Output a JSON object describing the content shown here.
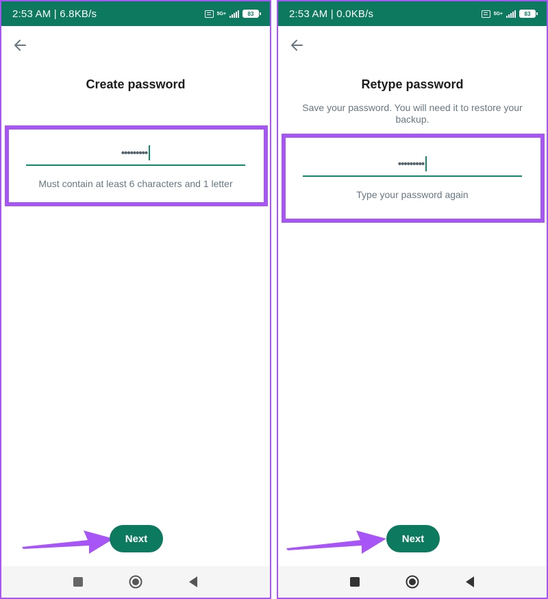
{
  "colors": {
    "accent": "#0d7a5f",
    "highlight": "#a855f7",
    "field_underline": "#0d8a6a"
  },
  "left": {
    "status": {
      "time": "2:53 AM | 6.8KB/s",
      "network_top": "5G+",
      "network_bottom": "",
      "battery": "83"
    },
    "title": "Create password",
    "password_masked": "•••••••••",
    "hint": "Must contain at least 6 characters and 1 letter",
    "next_label": "Next"
  },
  "right": {
    "status": {
      "time": "2:53 AM | 0.0KB/s",
      "network_top": "5G+",
      "network_bottom": "",
      "battery": "83"
    },
    "title": "Retype password",
    "subtitle": "Save your password. You will need it to restore your backup.",
    "password_masked": "•••••••••",
    "hint": "Type your password again",
    "next_label": "Next"
  },
  "icons": {
    "back": "back-arrow-icon",
    "nav_recents": "square-icon",
    "nav_home": "circle-icon",
    "nav_back": "triangle-icon",
    "annotation": "pointer-arrow-icon"
  }
}
